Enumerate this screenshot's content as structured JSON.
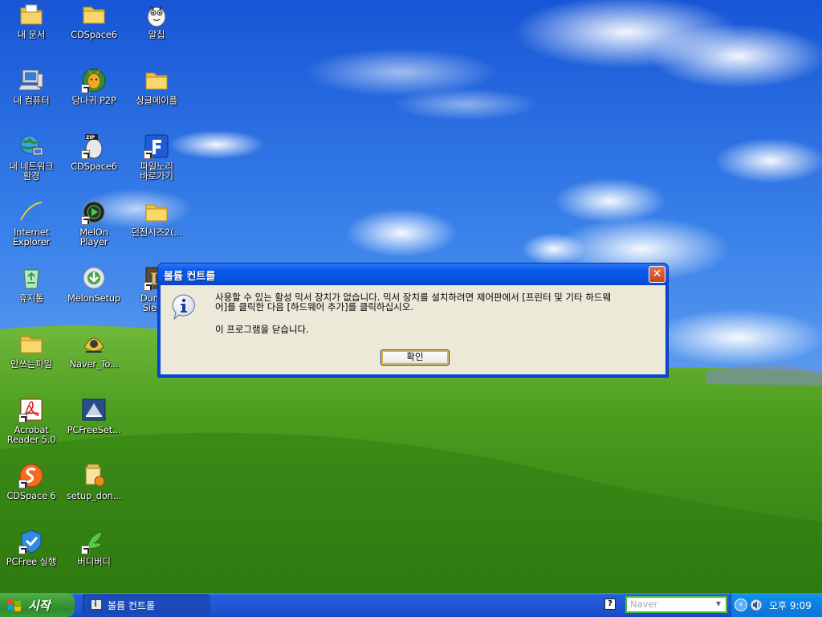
{
  "desktop": {
    "icons": [
      {
        "label": "내 문서",
        "icon": "my-documents-folder"
      },
      {
        "label": "CDSpace6",
        "icon": "folder"
      },
      {
        "label": "알집",
        "icon": "alzip-mascot"
      },
      {
        "label": "내 컴퓨터",
        "icon": "my-computer"
      },
      {
        "label": "당나귀 P2P",
        "icon": "donkey-p2p"
      },
      {
        "label": "싱글메이플",
        "icon": "folder"
      },
      {
        "label": "내 네트워크\n환경",
        "icon": "network-places"
      },
      {
        "label": "CDSpace6",
        "icon": "zip-egg"
      },
      {
        "label": "파일노리\n바로가기",
        "icon": "filenori-f"
      },
      {
        "label": "Internet\nExplorer",
        "icon": "internet-explorer"
      },
      {
        "label": "MelOn\nPlayer",
        "icon": "melon-player"
      },
      {
        "label": "던전시즈2(...",
        "icon": "folder"
      },
      {
        "label": "휴지통",
        "icon": "recycle-bin"
      },
      {
        "label": "MelonSetup",
        "icon": "melon-setup"
      },
      {
        "label": "Dung...\nSieg...",
        "icon": "dungeon-siege"
      },
      {
        "label": "안쓰는파일",
        "icon": "folder"
      },
      {
        "label": "Naver_To...",
        "icon": "naver-toolbar"
      },
      {
        "label": "Acrobat\nReader 5.0",
        "icon": "acrobat-reader"
      },
      {
        "label": "PCFreeSet...",
        "icon": "pcfree-setup"
      },
      {
        "label": "CDSpace 6",
        "icon": "cdspace-s"
      },
      {
        "label": "setup_don...",
        "icon": "setup-installer"
      },
      {
        "label": "PCFree 실행",
        "icon": "pcfree-shield"
      },
      {
        "label": "버디버디",
        "icon": "buddybuddy"
      }
    ]
  },
  "dialog": {
    "title": "볼륨 컨트롤",
    "close_label": "✕",
    "message_line1": "사용할 수 있는 활성 믹서 장치가 없습니다. 믹서 장치를 설치하려면 제어판에서 [프린터 및 기타 하드웨",
    "message_line2": "어]를 클릭한 다음 [하드웨어 추가]를 클릭하십시오.",
    "message_close": "이 프로그램을 닫습니다.",
    "ok_label": "확인"
  },
  "taskbar": {
    "start_label": "시작",
    "task_button_label": "볼륨 컨트롤",
    "help_label": "?",
    "search_placeholder": "Naver",
    "dropdown_glyph": "▼",
    "tray_chevron": "‹",
    "clock": "오후 9:09"
  }
}
